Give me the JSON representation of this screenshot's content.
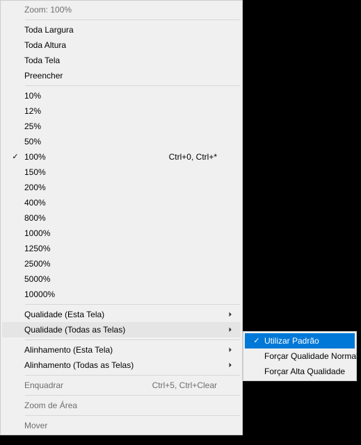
{
  "menu": {
    "header": "Zoom: 100%",
    "fit": [
      "Toda Largura",
      "Toda Altura",
      "Toda Tela",
      "Preencher"
    ],
    "zoom_levels": [
      {
        "label": "10%"
      },
      {
        "label": "12%"
      },
      {
        "label": "25%"
      },
      {
        "label": "50%"
      },
      {
        "label": "100%",
        "checked": true,
        "shortcut": "Ctrl+0, Ctrl+*"
      },
      {
        "label": "150%"
      },
      {
        "label": "200%"
      },
      {
        "label": "400%"
      },
      {
        "label": "800%"
      },
      {
        "label": "1000%"
      },
      {
        "label": "1250%"
      },
      {
        "label": "2500%"
      },
      {
        "label": "5000%"
      },
      {
        "label": "10000%"
      }
    ],
    "quality": [
      {
        "label": "Qualidade (Esta Tela)"
      },
      {
        "label": "Qualidade (Todas as Telas)",
        "hovered": true
      }
    ],
    "alignment": [
      {
        "label": "Alinhamento (Esta Tela)"
      },
      {
        "label": "Alinhamento (Todas as Telas)"
      }
    ],
    "frame": {
      "label": "Enquadrar",
      "shortcut": "Ctrl+5, Ctrl+Clear"
    },
    "zoom_area": "Zoom de Área",
    "move": "Mover"
  },
  "submenu": {
    "items": [
      {
        "label": "Utilizar Padrão",
        "checked": true,
        "selected": true
      },
      {
        "label": "Forçar Qualidade Normal"
      },
      {
        "label": "Forçar Alta Qualidade"
      }
    ]
  }
}
